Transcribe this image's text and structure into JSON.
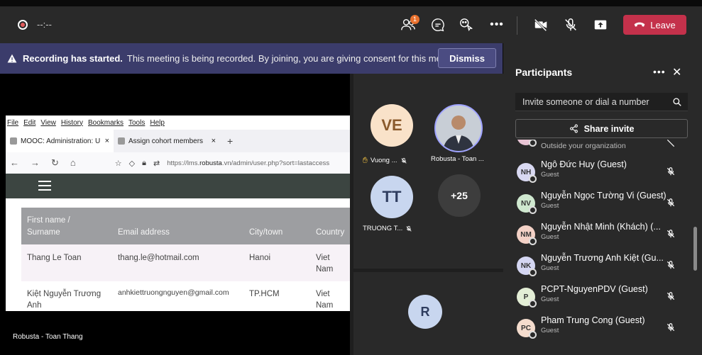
{
  "topbar": {
    "timer": "--:--",
    "participants_badge": "1",
    "leave_label": "Leave"
  },
  "banner": {
    "title": "Recording has started.",
    "message": "This meeting is being recorded. By joining, you are giving consent for this meeti...",
    "dismiss_label": "Dismiss"
  },
  "shared_screen": {
    "menu": [
      "File",
      "Edit",
      "View",
      "History",
      "Bookmarks",
      "Tools",
      "Help"
    ],
    "tabs": [
      {
        "label": "MOOC: Administration: Users: Ac"
      },
      {
        "label": "Assign cohort members"
      }
    ],
    "url_prefix": "https://lms.",
    "url_domain": "robusta",
    "url_suffix": ".vn/admin/user.php?sort=lastaccess",
    "table": {
      "headers": [
        "First name /",
        "Surname",
        "Email address",
        "City/town",
        "Country"
      ],
      "rows": [
        [
          "Thang Le Toan",
          "",
          "thang.le@hotmail.com",
          "Hanoi",
          "Viet",
          "Nam"
        ],
        [
          "Kiệt Nguyễn Trương",
          "Anh",
          "anhkiettruongnguyen@gmail.com",
          "TP.HCM",
          "Viet",
          "Nam"
        ]
      ]
    },
    "presenter": "Robusta - Toan Thang"
  },
  "gallery": {
    "tiles": [
      {
        "initials": "VE",
        "name": "Vuong ..."
      },
      {
        "initials": "",
        "name": "Robusta - Toan ..."
      },
      {
        "initials": "TT",
        "name": "TRUONG T..."
      },
      {
        "initials": "+25",
        "name": ""
      },
      {
        "initials": "R",
        "name": ""
      }
    ]
  },
  "panel": {
    "title": "Participants",
    "invite_placeholder": "Invite someone or dial a number",
    "share_invite": "Share invite",
    "outside_label": "Outside your organization",
    "participants": [
      {
        "initials": "NH",
        "name": "Ngô Đức Huy (Guest)",
        "sub": "Guest",
        "color": "#d9d9f2"
      },
      {
        "initials": "NV",
        "name": "Nguyễn Ngọc Tường Vi (Guest)",
        "sub": "Guest",
        "color": "#cfe8cf"
      },
      {
        "initials": "NM",
        "name": "Nguyễn Nhật Minh (Khách) (...",
        "sub": "Guest",
        "color": "#f3d1c6"
      },
      {
        "initials": "NK",
        "name": "Nguyễn Trương Anh Kiệt (Gu...",
        "sub": "Guest",
        "color": "#d4d6f2"
      },
      {
        "initials": "P",
        "name": "PCPT-NguyenPDV (Guest)",
        "sub": "Guest",
        "color": "#e3eed6"
      },
      {
        "initials": "PC",
        "name": "Pham Trung Cong (Guest)",
        "sub": "Guest",
        "color": "#f4dccd"
      }
    ]
  }
}
